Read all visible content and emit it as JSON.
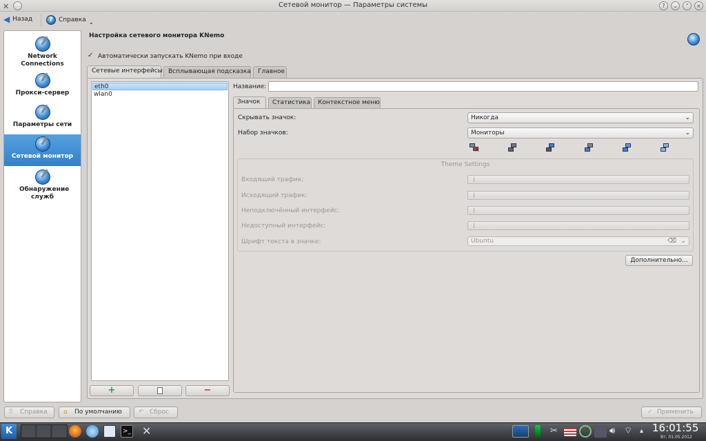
{
  "window": {
    "title": "Сетевой монитор — Параметры системы"
  },
  "toolbar": {
    "back_label": "Назад",
    "help_label": "Справка"
  },
  "sidebar": {
    "items": [
      {
        "label": "Network Connections"
      },
      {
        "label": "Прокси-сервер"
      },
      {
        "label": "Параметры сети"
      },
      {
        "label": "Сетевой монитор",
        "selected": true
      },
      {
        "label": "Обнаружение служб"
      }
    ]
  },
  "main": {
    "title": "Настройка сетевого монитора KNemo",
    "autostart_label": "Автоматически запускать KNemo при входе",
    "tabs": [
      "Сетевые интерфейсы",
      "Всплывающая подсказка",
      "Главное"
    ],
    "interfaces": [
      "eth0",
      "wlan0"
    ],
    "name_label": "Название:",
    "name_value": "",
    "subtabs": [
      "Значок",
      "Статистика",
      "Контекстное меню"
    ],
    "hide_icon_label": "Скрывать значок:",
    "hide_icon_value": "Никогда",
    "icon_set_label": "Набор значков:",
    "icon_set_value": "Мониторы",
    "theme": {
      "title": "Theme Settings",
      "incoming": "Входящий трафик:",
      "outgoing": "Исходящий трафик:",
      "disconnected": "Неподключённый интерфейс:",
      "unavailable": "Недоступный интерфейс:",
      "font_label": "Шрифт текста в значке:",
      "font_value": "Ubuntu"
    },
    "more_button": "Дополнительно..."
  },
  "bottom": {
    "help": "Справка",
    "defaults": "По умолчанию",
    "reset": "Сброс",
    "apply": "Применить"
  },
  "taskbar": {
    "time": "16:01:55",
    "date": "Вт, 01.05.2012"
  },
  "colors": {
    "selection": "#3481c8",
    "accent": "#2a6fb8"
  }
}
